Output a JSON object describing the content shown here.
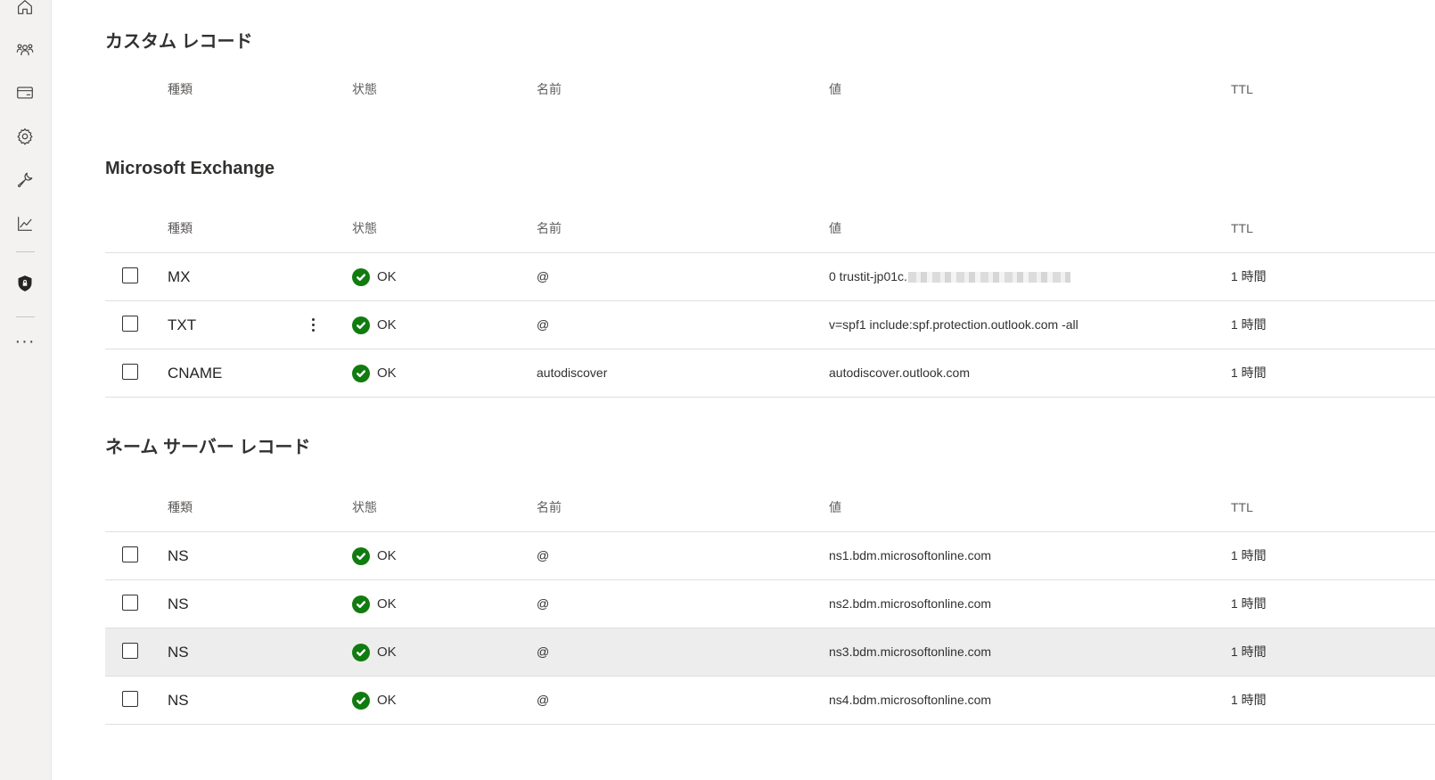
{
  "columns": {
    "type": "種類",
    "status": "状態",
    "name": "名前",
    "value": "値",
    "ttl": "TTL"
  },
  "sections": {
    "custom": {
      "title": "カスタム レコード",
      "rows": []
    },
    "exchange": {
      "title": "Microsoft Exchange",
      "rows": [
        {
          "type": "MX",
          "status": "OK",
          "name": "@",
          "value": "0 trustit-jp01c.",
          "value_redacted": true,
          "ttl": "1 時間"
        },
        {
          "type": "TXT",
          "status": "OK",
          "name": "@",
          "value": "v=spf1 include:spf.protection.outlook.com -all",
          "ttl": "1 時間"
        },
        {
          "type": "CNAME",
          "status": "OK",
          "name": "autodiscover",
          "value": "autodiscover.outlook.com",
          "ttl": "1 時間"
        }
      ]
    },
    "nameserver": {
      "title": "ネーム サーバー レコード",
      "rows": [
        {
          "type": "NS",
          "status": "OK",
          "name": "@",
          "value": "ns1.bdm.microsoftonline.com",
          "ttl": "1 時間"
        },
        {
          "type": "NS",
          "status": "OK",
          "name": "@",
          "value": "ns2.bdm.microsoftonline.com",
          "ttl": "1 時間"
        },
        {
          "type": "NS",
          "status": "OK",
          "name": "@",
          "value": "ns3.bdm.microsoftonline.com",
          "ttl": "1 時間"
        },
        {
          "type": "NS",
          "status": "OK",
          "name": "@",
          "value": "ns4.bdm.microsoftonline.com",
          "ttl": "1 時間"
        }
      ]
    }
  },
  "nav_rail": {
    "icons": [
      "home-icon",
      "groups-icon",
      "billing-icon",
      "settings-icon",
      "setup-icon",
      "reports-icon",
      "security-icon",
      "more-icon"
    ],
    "more_label": "···"
  },
  "colors": {
    "status_ok": "#107c10",
    "row_hover": "#ededed",
    "rail_bg": "#f3f2f1"
  }
}
